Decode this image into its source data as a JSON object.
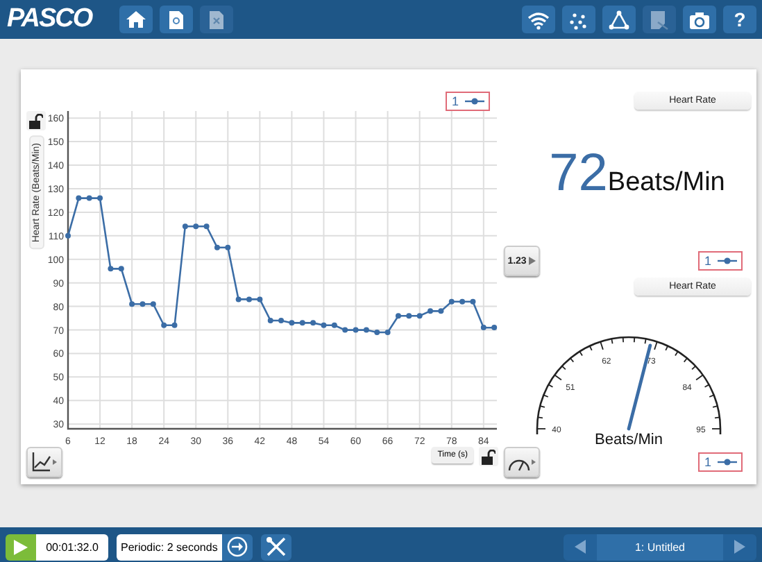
{
  "toolbar_left": [
    {
      "kind": "home",
      "disabled": false
    },
    {
      "kind": "new-file",
      "disabled": false
    },
    {
      "kind": "close-file",
      "disabled": true
    }
  ],
  "logo": "PASCO",
  "toolbar_right": [
    {
      "kind": "wifi",
      "disabled": false
    },
    {
      "kind": "dots",
      "disabled": false
    },
    {
      "kind": "triangle",
      "disabled": false
    },
    {
      "kind": "pen-page",
      "disabled": true
    },
    {
      "kind": "camera",
      "disabled": false
    },
    {
      "kind": "help",
      "label": "?",
      "disabled": false
    }
  ],
  "graph": {
    "chart_data": {
      "type": "line",
      "grid": true,
      "xlabel": "Time (s)",
      "ylabel": "Heart Rate (Beats/Min)",
      "x": [
        6,
        8,
        10,
        12,
        14,
        16,
        18,
        20,
        22,
        24,
        26,
        28,
        30,
        32,
        34,
        36,
        38,
        40,
        42,
        44,
        46,
        48,
        50,
        52,
        54,
        56,
        58,
        60,
        62,
        64,
        66,
        68,
        70,
        72,
        74,
        76,
        78,
        80,
        82,
        84,
        86
      ],
      "series": [
        {
          "name": "1",
          "color": "#3b6da6",
          "marker": "circle",
          "values": [
            110,
            126,
            126,
            126,
            96,
            96,
            81,
            81,
            81,
            72,
            72,
            114,
            114,
            114,
            105,
            105,
            83,
            83,
            83,
            74,
            74,
            73,
            73,
            73,
            72,
            72,
            70,
            70,
            70,
            69,
            69,
            76,
            76,
            76,
            78,
            78,
            82,
            82,
            82,
            71,
            71
          ]
        }
      ],
      "xlim": [
        6,
        86.5
      ],
      "ylim": [
        28,
        163
      ],
      "xticks": [
        6,
        12,
        18,
        24,
        30,
        36,
        42,
        48,
        54,
        60,
        66,
        72,
        78,
        84
      ],
      "yticks": [
        30,
        40,
        50,
        60,
        70,
        80,
        90,
        100,
        110,
        120,
        130,
        140,
        150,
        160
      ]
    }
  },
  "digits": {
    "title": "Heart Rate",
    "value": "72",
    "unit": "Beats/Min",
    "button": "1.23",
    "legend": "1"
  },
  "gauge": {
    "title": "Heart Rate",
    "labels": [
      "40",
      "51",
      "62",
      "73",
      "84",
      "95"
    ],
    "unit": "Beats/Min",
    "level": 0.58,
    "legend": "1"
  },
  "bottom_bar": {
    "elapsed": "00:01:32.0",
    "sampling": "Periodic: 2 seconds",
    "page": "1: Untitled"
  }
}
